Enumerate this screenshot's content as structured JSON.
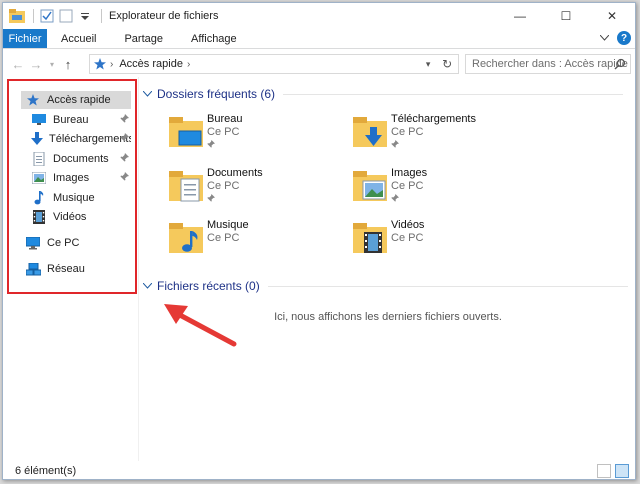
{
  "window": {
    "title": "Explorateur de fichiers",
    "minimize": "—",
    "maximize": "☐",
    "close": "✕"
  },
  "ribbon": {
    "file_tab": "Fichier",
    "tabs": [
      "Accueil",
      "Partage",
      "Affichage"
    ],
    "help": "?"
  },
  "address": {
    "crumb": "Accès rapide",
    "search_placeholder": "Rechercher dans : Accès rapide"
  },
  "nav": {
    "quick_access": "Accès rapide",
    "pinned": [
      "Bureau",
      "Téléchargements",
      "Documents",
      "Images"
    ],
    "unpinned": [
      "Musique",
      "Vidéos"
    ],
    "this_pc": "Ce PC",
    "network": "Réseau"
  },
  "frequent": {
    "title": "Dossiers fréquents (6)",
    "folders": [
      {
        "name": "Bureau",
        "location": "Ce PC"
      },
      {
        "name": "Téléchargements",
        "location": "Ce PC"
      },
      {
        "name": "Documents",
        "location": "Ce PC"
      },
      {
        "name": "Images",
        "location": "Ce PC"
      },
      {
        "name": "Musique",
        "location": "Ce PC"
      },
      {
        "name": "Vidéos",
        "location": "Ce PC"
      }
    ]
  },
  "recent": {
    "title": "Fichiers récents (0)",
    "empty_message": "Ici, nous affichons les derniers fichiers ouverts."
  },
  "status": {
    "item_count": "6 élément(s)"
  },
  "colors": {
    "accent": "#1979ca",
    "group_title": "#1e3287",
    "highlight": "#e0262a",
    "folder": "#f5c95c"
  }
}
